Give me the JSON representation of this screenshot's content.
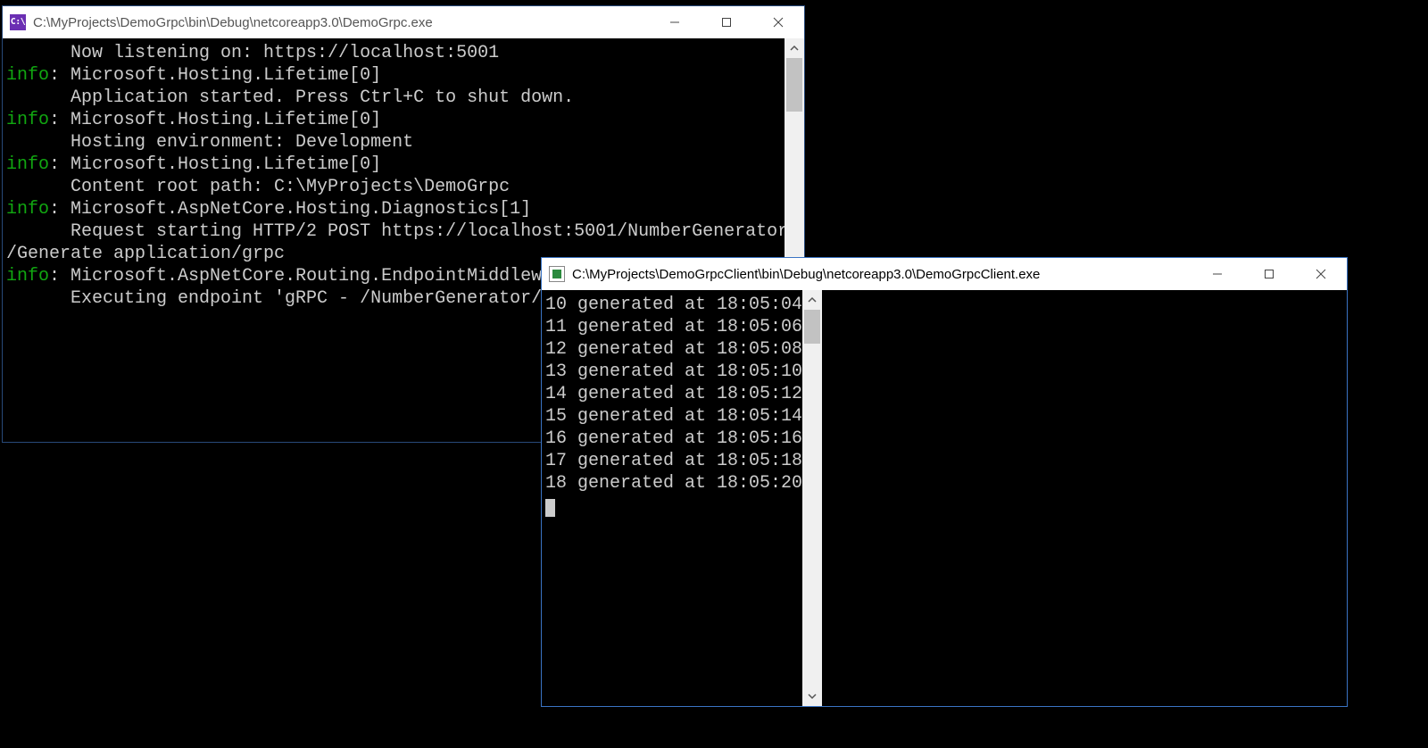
{
  "server_window": {
    "title": "C:\\MyProjects\\DemoGrpc\\bin\\Debug\\netcoreapp3.0\\DemoGrpc.exe",
    "icon_text": "C:\\",
    "lines": [
      {
        "prefix": "",
        "text": "      Now listening on: https://localhost:5001"
      },
      {
        "prefix": "info:",
        "text": " Microsoft.Hosting.Lifetime[0]"
      },
      {
        "prefix": "",
        "text": "      Application started. Press Ctrl+C to shut down."
      },
      {
        "prefix": "info:",
        "text": " Microsoft.Hosting.Lifetime[0]"
      },
      {
        "prefix": "",
        "text": "      Hosting environment: Development"
      },
      {
        "prefix": "info:",
        "text": " Microsoft.Hosting.Lifetime[0]"
      },
      {
        "prefix": "",
        "text": "      Content root path: C:\\MyProjects\\DemoGrpc"
      },
      {
        "prefix": "info:",
        "text": " Microsoft.AspNetCore.Hosting.Diagnostics[1]"
      },
      {
        "prefix": "",
        "text": "      Request starting HTTP/2 POST https://localhost:5001/NumberGenerator"
      },
      {
        "prefix": "",
        "text": "/Generate application/grpc"
      },
      {
        "prefix": "info:",
        "text": " Microsoft.AspNetCore.Routing.EndpointMiddlewa"
      },
      {
        "prefix": "",
        "text": "      Executing endpoint 'gRPC - /NumberGenerator/G"
      }
    ]
  },
  "client_window": {
    "title": "C:\\MyProjects\\DemoGrpcClient\\bin\\Debug\\netcoreapp3.0\\DemoGrpcClient.exe",
    "lines": [
      "10 generated at 18:05:04",
      "11 generated at 18:05:06",
      "12 generated at 18:05:08",
      "13 generated at 18:05:10",
      "14 generated at 18:05:12",
      "15 generated at 18:05:14",
      "16 generated at 18:05:16",
      "17 generated at 18:05:18",
      "18 generated at 18:05:20"
    ]
  }
}
